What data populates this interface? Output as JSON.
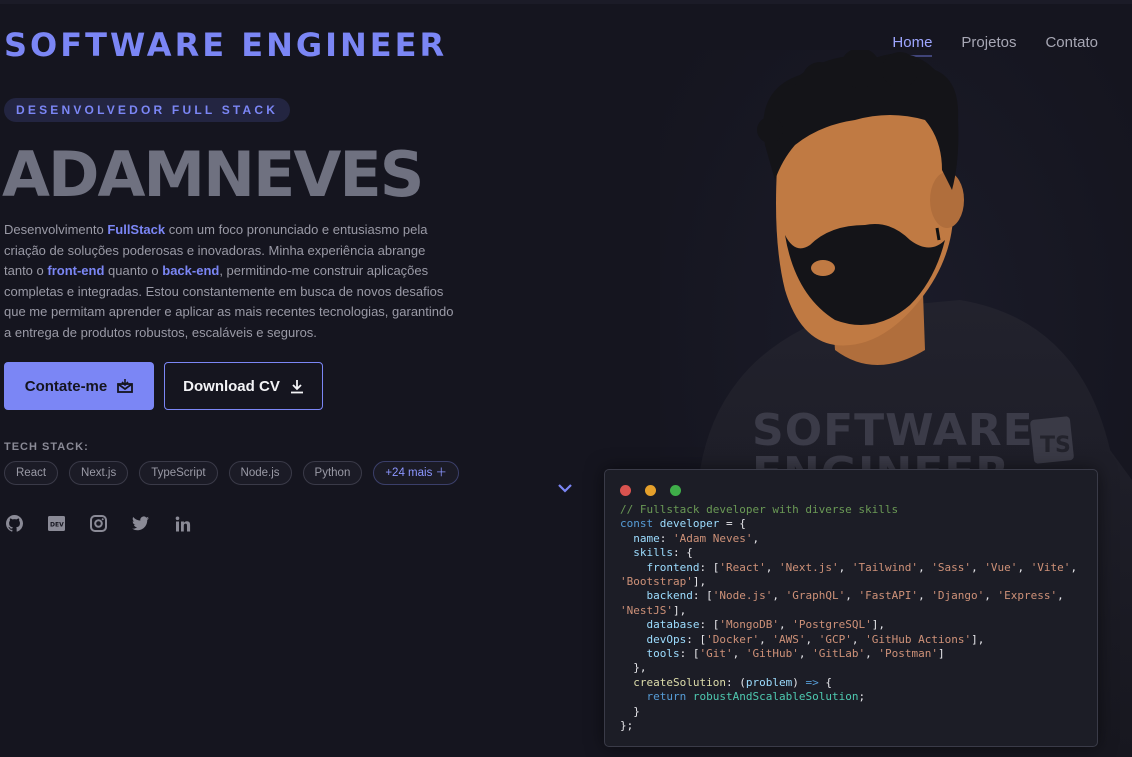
{
  "header": {
    "brand": "SOFTWARE ENGINEER",
    "nav": [
      {
        "label": "Home",
        "active": true
      },
      {
        "label": "Projetos",
        "active": false
      },
      {
        "label": "Contato",
        "active": false
      }
    ]
  },
  "hero": {
    "badge": "DESENVOLVEDOR FULL STACK",
    "name": "ADAMNEVES",
    "description": {
      "p1": "Desenvolvimento ",
      "h1": "FullStack",
      "p2": " com um foco pronunciado e entusiasmo pela criação de soluções poderosas e inovadoras. Minha experiência abrange tanto o ",
      "h2": "front-end",
      "p3": " quanto o ",
      "h3": "back-end",
      "p4": ", permitindo-me construir aplicações completas e integradas. Estou constantemente em busca de novos desafios que me permitam aprender e aplicar as mais recentes tecnologias, garantindo a entrega de produtos robustos, escaláveis e seguros."
    },
    "buttons": {
      "contact": "Contate-me",
      "download": "Download CV"
    },
    "tech_stack": {
      "label": "TECH STACK:",
      "chips": [
        "React",
        "Next.js",
        "TypeScript",
        "Node.js",
        "Python"
      ],
      "more": "+24 mais ＋"
    },
    "socials": [
      "github-icon",
      "dev-icon",
      "instagram-icon",
      "twitter-icon",
      "linkedin-icon"
    ]
  },
  "portrait": {
    "shirt_text_line1": "SOFTWARE",
    "shirt_text_line2": "ENGINEER",
    "sleeve_badge": "TS"
  },
  "code_window": {
    "dot_colors": [
      "#ff5f57",
      "#febc2e",
      "#28c840"
    ],
    "comment": "// Fullstack developer with diverse skills",
    "name": "'Adam Neves'",
    "frontend": [
      "'React'",
      "'Next.js'",
      "'Tailwind'",
      "'Sass'",
      "'Vue'",
      "'Vite'",
      "'Bootstrap'"
    ],
    "backend": [
      "'Node.js'",
      "'GraphQL'",
      "'FastAPI'",
      "'Django'",
      "'Express'",
      "'NestJS'"
    ],
    "database": [
      "'MongoDB'",
      "'PostgreSQL'"
    ],
    "devOps": [
      "'Docker'",
      "'AWS'",
      "'GCP'",
      "'GitHub Actions'"
    ],
    "tools": [
      "'Git'",
      "'GitHub'",
      "'GitLab'",
      "'Postman'"
    ],
    "return_value": "robustAndScalableSolution"
  },
  "colors": {
    "accent": "#7b86f5",
    "background": "#15151f",
    "code_bg": "#1c1d26"
  }
}
